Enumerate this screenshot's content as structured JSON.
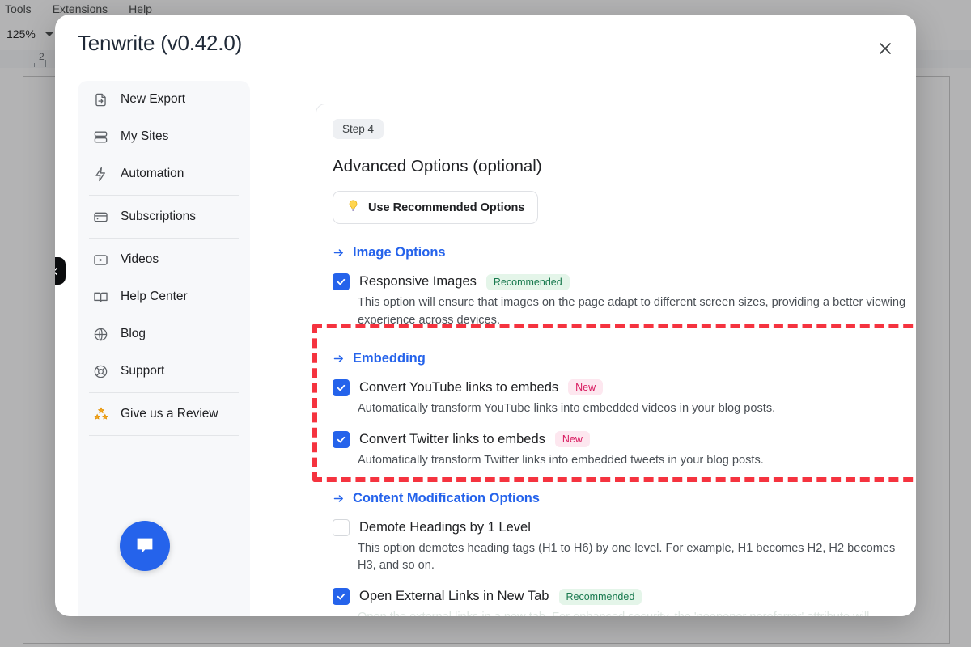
{
  "backdrop": {
    "menu_items": [
      "Tools",
      "Extensions",
      "Help"
    ],
    "zoom_level": "125%",
    "ruler_mark": "2"
  },
  "modal": {
    "title": "Tenwrite (v0.42.0)",
    "close_label": "×",
    "close_icon": "close-icon"
  },
  "sidebar": {
    "items": [
      {
        "label": "New Export",
        "icon": "file-export-icon"
      },
      {
        "label": "My Sites",
        "icon": "server-stack-icon"
      },
      {
        "label": "Automation",
        "icon": "lightning-bolt-icon"
      },
      {
        "label": "Subscriptions",
        "icon": "credit-card-icon"
      },
      {
        "label": "Videos",
        "icon": "video-play-icon"
      },
      {
        "label": "Help Center",
        "icon": "open-book-icon"
      },
      {
        "label": "Blog",
        "icon": "globe-icon"
      },
      {
        "label": "Support",
        "icon": "lifebuoy-icon"
      },
      {
        "label": "Give us a Review",
        "icon": "stars-icon"
      }
    ],
    "collapse_icon": "chevron-left-icon",
    "chat_icon": "chat-bubble-icon",
    "chat_color": "#2563eb"
  },
  "main": {
    "step_badge": "Step 4",
    "heading": "Advanced Options (optional)",
    "recommended_button": {
      "label": "Use Recommended Options",
      "icon": "lightbulb-icon"
    },
    "groups": [
      {
        "title": "Image Options",
        "arrow_icon": "arrow-right-icon",
        "options": [
          {
            "label": "Responsive Images",
            "badge": "Recommended",
            "badge_type": "recommended",
            "checked": true,
            "description": "This option will ensure that images on the page adapt to different screen sizes, providing a better viewing experience across devices."
          }
        ]
      },
      {
        "title": "Embedding",
        "arrow_icon": "arrow-right-icon",
        "highlighted": true,
        "options": [
          {
            "label": "Convert YouTube links to embeds",
            "badge": "New",
            "badge_type": "new",
            "checked": true,
            "description": "Automatically transform YouTube links into embedded videos in your blog posts."
          },
          {
            "label": "Convert Twitter links to embeds",
            "badge": "New",
            "badge_type": "new",
            "checked": true,
            "description": "Automatically transform Twitter links into embedded tweets in your blog posts."
          }
        ]
      },
      {
        "title": "Content Modification Options",
        "arrow_icon": "arrow-right-icon",
        "options": [
          {
            "label": "Demote Headings by 1 Level",
            "badge": "",
            "badge_type": "",
            "checked": false,
            "description": "This option demotes heading tags (H1 to H6) by one level. For example, H1 becomes H2, H2 becomes H3, and so on."
          },
          {
            "label": "Open External Links in New Tab",
            "badge": "Recommended",
            "badge_type": "recommended",
            "checked": true,
            "description": "Open the external links in a new tab. For enhanced security, the 'noopener noreferrer' attribute will"
          }
        ]
      }
    ]
  },
  "colors": {
    "accent": "#2563eb",
    "annotation": "#f5333f",
    "badge_new_bg": "#fde7ef",
    "badge_new_fg": "#d81b60",
    "badge_rec_bg": "#e4f5e9",
    "badge_rec_fg": "#18794e"
  }
}
